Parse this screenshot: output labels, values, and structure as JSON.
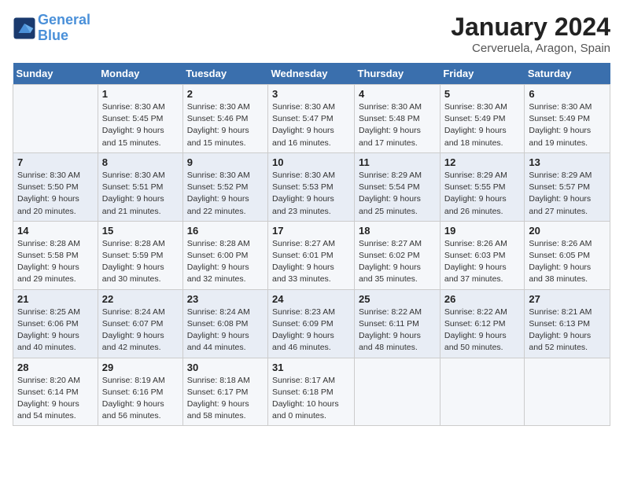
{
  "header": {
    "logo_line1": "General",
    "logo_line2": "Blue",
    "month": "January 2024",
    "location": "Cerveruela, Aragon, Spain"
  },
  "weekdays": [
    "Sunday",
    "Monday",
    "Tuesday",
    "Wednesday",
    "Thursday",
    "Friday",
    "Saturday"
  ],
  "weeks": [
    [
      {
        "day": "",
        "sunrise": "",
        "sunset": "",
        "daylight": ""
      },
      {
        "day": "1",
        "sunrise": "Sunrise: 8:30 AM",
        "sunset": "Sunset: 5:45 PM",
        "daylight": "Daylight: 9 hours and 15 minutes."
      },
      {
        "day": "2",
        "sunrise": "Sunrise: 8:30 AM",
        "sunset": "Sunset: 5:46 PM",
        "daylight": "Daylight: 9 hours and 15 minutes."
      },
      {
        "day": "3",
        "sunrise": "Sunrise: 8:30 AM",
        "sunset": "Sunset: 5:47 PM",
        "daylight": "Daylight: 9 hours and 16 minutes."
      },
      {
        "day": "4",
        "sunrise": "Sunrise: 8:30 AM",
        "sunset": "Sunset: 5:48 PM",
        "daylight": "Daylight: 9 hours and 17 minutes."
      },
      {
        "day": "5",
        "sunrise": "Sunrise: 8:30 AM",
        "sunset": "Sunset: 5:49 PM",
        "daylight": "Daylight: 9 hours and 18 minutes."
      },
      {
        "day": "6",
        "sunrise": "Sunrise: 8:30 AM",
        "sunset": "Sunset: 5:49 PM",
        "daylight": "Daylight: 9 hours and 19 minutes."
      }
    ],
    [
      {
        "day": "7",
        "sunrise": "Sunrise: 8:30 AM",
        "sunset": "Sunset: 5:50 PM",
        "daylight": "Daylight: 9 hours and 20 minutes."
      },
      {
        "day": "8",
        "sunrise": "Sunrise: 8:30 AM",
        "sunset": "Sunset: 5:51 PM",
        "daylight": "Daylight: 9 hours and 21 minutes."
      },
      {
        "day": "9",
        "sunrise": "Sunrise: 8:30 AM",
        "sunset": "Sunset: 5:52 PM",
        "daylight": "Daylight: 9 hours and 22 minutes."
      },
      {
        "day": "10",
        "sunrise": "Sunrise: 8:30 AM",
        "sunset": "Sunset: 5:53 PM",
        "daylight": "Daylight: 9 hours and 23 minutes."
      },
      {
        "day": "11",
        "sunrise": "Sunrise: 8:29 AM",
        "sunset": "Sunset: 5:54 PM",
        "daylight": "Daylight: 9 hours and 25 minutes."
      },
      {
        "day": "12",
        "sunrise": "Sunrise: 8:29 AM",
        "sunset": "Sunset: 5:55 PM",
        "daylight": "Daylight: 9 hours and 26 minutes."
      },
      {
        "day": "13",
        "sunrise": "Sunrise: 8:29 AM",
        "sunset": "Sunset: 5:57 PM",
        "daylight": "Daylight: 9 hours and 27 minutes."
      }
    ],
    [
      {
        "day": "14",
        "sunrise": "Sunrise: 8:28 AM",
        "sunset": "Sunset: 5:58 PM",
        "daylight": "Daylight: 9 hours and 29 minutes."
      },
      {
        "day": "15",
        "sunrise": "Sunrise: 8:28 AM",
        "sunset": "Sunset: 5:59 PM",
        "daylight": "Daylight: 9 hours and 30 minutes."
      },
      {
        "day": "16",
        "sunrise": "Sunrise: 8:28 AM",
        "sunset": "Sunset: 6:00 PM",
        "daylight": "Daylight: 9 hours and 32 minutes."
      },
      {
        "day": "17",
        "sunrise": "Sunrise: 8:27 AM",
        "sunset": "Sunset: 6:01 PM",
        "daylight": "Daylight: 9 hours and 33 minutes."
      },
      {
        "day": "18",
        "sunrise": "Sunrise: 8:27 AM",
        "sunset": "Sunset: 6:02 PM",
        "daylight": "Daylight: 9 hours and 35 minutes."
      },
      {
        "day": "19",
        "sunrise": "Sunrise: 8:26 AM",
        "sunset": "Sunset: 6:03 PM",
        "daylight": "Daylight: 9 hours and 37 minutes."
      },
      {
        "day": "20",
        "sunrise": "Sunrise: 8:26 AM",
        "sunset": "Sunset: 6:05 PM",
        "daylight": "Daylight: 9 hours and 38 minutes."
      }
    ],
    [
      {
        "day": "21",
        "sunrise": "Sunrise: 8:25 AM",
        "sunset": "Sunset: 6:06 PM",
        "daylight": "Daylight: 9 hours and 40 minutes."
      },
      {
        "day": "22",
        "sunrise": "Sunrise: 8:24 AM",
        "sunset": "Sunset: 6:07 PM",
        "daylight": "Daylight: 9 hours and 42 minutes."
      },
      {
        "day": "23",
        "sunrise": "Sunrise: 8:24 AM",
        "sunset": "Sunset: 6:08 PM",
        "daylight": "Daylight: 9 hours and 44 minutes."
      },
      {
        "day": "24",
        "sunrise": "Sunrise: 8:23 AM",
        "sunset": "Sunset: 6:09 PM",
        "daylight": "Daylight: 9 hours and 46 minutes."
      },
      {
        "day": "25",
        "sunrise": "Sunrise: 8:22 AM",
        "sunset": "Sunset: 6:11 PM",
        "daylight": "Daylight: 9 hours and 48 minutes."
      },
      {
        "day": "26",
        "sunrise": "Sunrise: 8:22 AM",
        "sunset": "Sunset: 6:12 PM",
        "daylight": "Daylight: 9 hours and 50 minutes."
      },
      {
        "day": "27",
        "sunrise": "Sunrise: 8:21 AM",
        "sunset": "Sunset: 6:13 PM",
        "daylight": "Daylight: 9 hours and 52 minutes."
      }
    ],
    [
      {
        "day": "28",
        "sunrise": "Sunrise: 8:20 AM",
        "sunset": "Sunset: 6:14 PM",
        "daylight": "Daylight: 9 hours and 54 minutes."
      },
      {
        "day": "29",
        "sunrise": "Sunrise: 8:19 AM",
        "sunset": "Sunset: 6:16 PM",
        "daylight": "Daylight: 9 hours and 56 minutes."
      },
      {
        "day": "30",
        "sunrise": "Sunrise: 8:18 AM",
        "sunset": "Sunset: 6:17 PM",
        "daylight": "Daylight: 9 hours and 58 minutes."
      },
      {
        "day": "31",
        "sunrise": "Sunrise: 8:17 AM",
        "sunset": "Sunset: 6:18 PM",
        "daylight": "Daylight: 10 hours and 0 minutes."
      },
      {
        "day": "",
        "sunrise": "",
        "sunset": "",
        "daylight": ""
      },
      {
        "day": "",
        "sunrise": "",
        "sunset": "",
        "daylight": ""
      },
      {
        "day": "",
        "sunrise": "",
        "sunset": "",
        "daylight": ""
      }
    ]
  ]
}
